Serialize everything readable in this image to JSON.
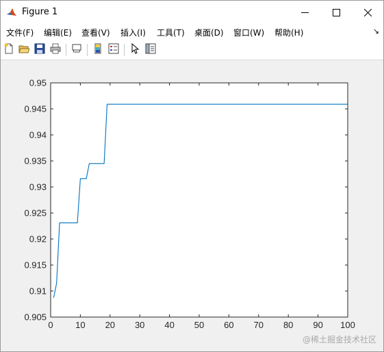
{
  "window": {
    "title": "Figure 1",
    "minimize_icon": "minimize-icon",
    "maximize_icon": "maximize-icon",
    "close_icon": "close-icon",
    "app_icon": "matlab-icon"
  },
  "menu": {
    "items": [
      {
        "label": "文件(F)"
      },
      {
        "label": "编辑(E)"
      },
      {
        "label": "查看(V)"
      },
      {
        "label": "插入(I)"
      },
      {
        "label": "工具(T)"
      },
      {
        "label": "桌面(D)"
      },
      {
        "label": "窗口(W)"
      },
      {
        "label": "帮助(H)"
      }
    ],
    "dock_arrow": "↘"
  },
  "toolbar": {
    "buttons": [
      {
        "icon": "new-figure-icon"
      },
      {
        "icon": "open-file-icon"
      },
      {
        "icon": "save-icon"
      },
      {
        "icon": "print-icon"
      },
      {
        "icon": "link-plot-icon"
      },
      {
        "icon": "insert-colorbar-icon"
      },
      {
        "icon": "insert-legend-icon"
      },
      {
        "icon": "edit-plot-arrow-icon"
      },
      {
        "icon": "show-plot-tools-icon"
      }
    ]
  },
  "chart_data": {
    "type": "line",
    "title": "",
    "xlabel": "",
    "ylabel": "",
    "xlim": [
      0,
      100
    ],
    "ylim": [
      0.905,
      0.95
    ],
    "xticks": [
      "0",
      "10",
      "20",
      "30",
      "40",
      "50",
      "60",
      "70",
      "80",
      "90",
      "100"
    ],
    "yticks": [
      "0.905",
      "0.91",
      "0.915",
      "0.92",
      "0.925",
      "0.93",
      "0.935",
      "0.94",
      "0.945",
      "0.95"
    ],
    "grid": false,
    "color": "#0072bd",
    "series": [
      {
        "x": [
          1,
          2,
          3,
          4,
          5,
          6,
          7,
          8,
          9,
          10,
          11,
          12,
          13,
          14,
          15,
          16,
          17,
          18,
          19,
          20,
          100
        ],
        "y": [
          0.9087,
          0.9115,
          0.9231,
          0.9231,
          0.9231,
          0.9231,
          0.9231,
          0.9231,
          0.9231,
          0.9316,
          0.9316,
          0.9316,
          0.9345,
          0.9345,
          0.9345,
          0.9345,
          0.9345,
          0.9345,
          0.9459,
          0.9459,
          0.9459
        ]
      }
    ]
  },
  "watermark": "@稀土掘金技术社区"
}
